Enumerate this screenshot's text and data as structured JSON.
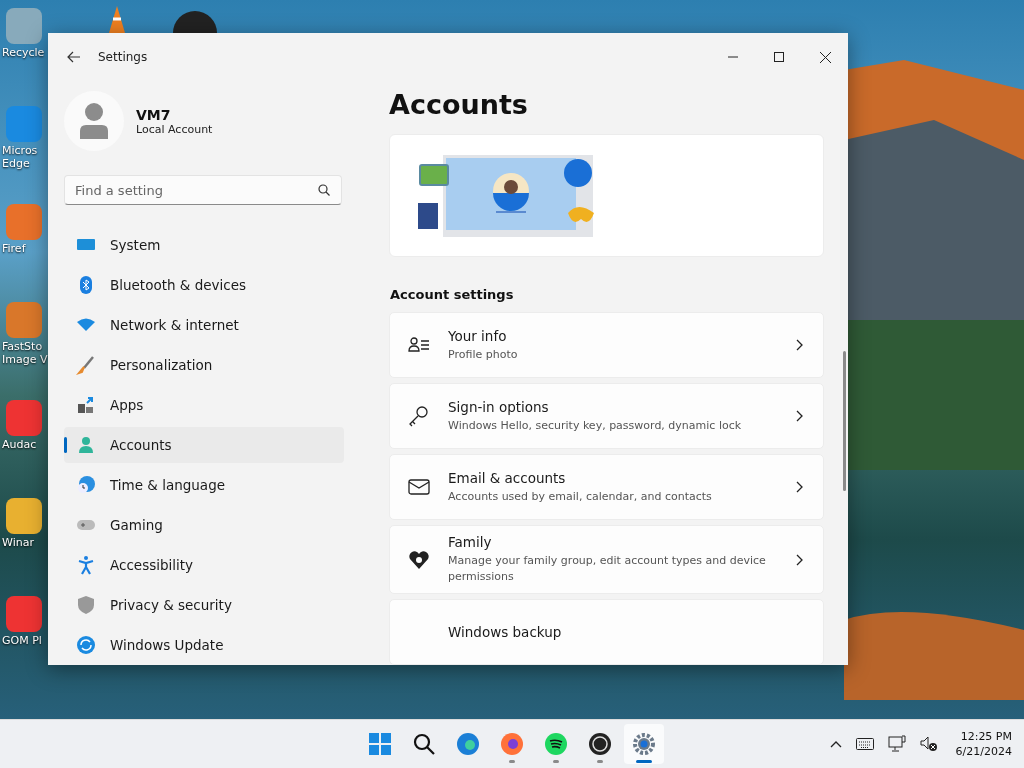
{
  "desktop_icons": [
    {
      "label": "Recycle"
    },
    {
      "label": "Micros Edge"
    },
    {
      "label": "Firef"
    },
    {
      "label": "FastSto Image V"
    },
    {
      "label": "Audac"
    },
    {
      "label": "Winar"
    },
    {
      "label": "GOM Pl"
    }
  ],
  "window": {
    "title": "Settings"
  },
  "profile": {
    "name": "VM7",
    "account_type": "Local Account"
  },
  "search": {
    "placeholder": "Find a setting"
  },
  "sidebar": {
    "items": [
      {
        "label": "System",
        "selected": false
      },
      {
        "label": "Bluetooth & devices",
        "selected": false
      },
      {
        "label": "Network & internet",
        "selected": false
      },
      {
        "label": "Personalization",
        "selected": false
      },
      {
        "label": "Apps",
        "selected": false
      },
      {
        "label": "Accounts",
        "selected": true
      },
      {
        "label": "Time & language",
        "selected": false
      },
      {
        "label": "Gaming",
        "selected": false
      },
      {
        "label": "Accessibility",
        "selected": false
      },
      {
        "label": "Privacy & security",
        "selected": false
      },
      {
        "label": "Windows Update",
        "selected": false
      }
    ]
  },
  "page": {
    "title": "Accounts",
    "section": "Account settings",
    "cards": [
      {
        "title": "Your info",
        "subtitle": "Profile photo"
      },
      {
        "title": "Sign-in options",
        "subtitle": "Windows Hello, security key, password, dynamic lock"
      },
      {
        "title": "Email & accounts",
        "subtitle": "Accounts used by email, calendar, and contacts"
      },
      {
        "title": "Family",
        "subtitle": "Manage your family group, edit account types and device permissions"
      },
      {
        "title": "Windows backup"
      }
    ]
  },
  "taskbar": {
    "apps": [
      {
        "running": false,
        "selected": false
      },
      {
        "running": false,
        "selected": false
      },
      {
        "running": false,
        "selected": false
      },
      {
        "running": true,
        "selected": false
      },
      {
        "running": true,
        "selected": false
      },
      {
        "running": true,
        "selected": false
      },
      {
        "running": true,
        "selected": true
      }
    ],
    "time": "12:25 PM",
    "date": "6/21/2024"
  }
}
